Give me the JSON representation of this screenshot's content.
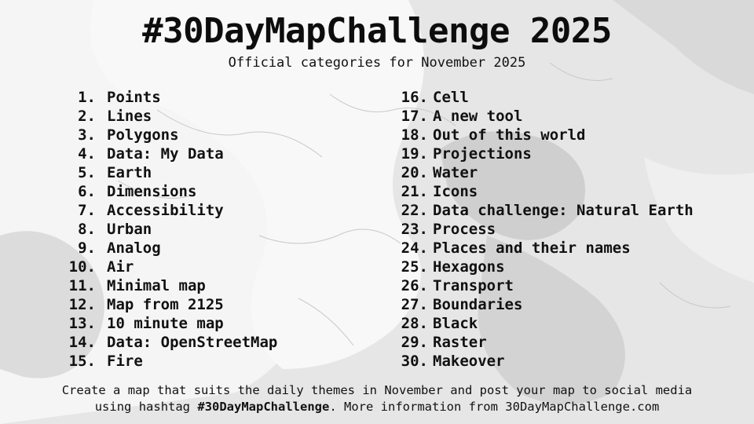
{
  "title": "#30DayMapChallenge 2025",
  "subtitle": "Official categories for November 2025",
  "categories_left": [
    {
      "num": "1.",
      "label": "Points"
    },
    {
      "num": "2.",
      "label": "Lines"
    },
    {
      "num": "3.",
      "label": "Polygons"
    },
    {
      "num": "4.",
      "label": "Data: My Data"
    },
    {
      "num": "5.",
      "label": "Earth"
    },
    {
      "num": "6.",
      "label": "Dimensions"
    },
    {
      "num": "7.",
      "label": "Accessibility"
    },
    {
      "num": "8.",
      "label": "Urban"
    },
    {
      "num": "9.",
      "label": "Analog"
    },
    {
      "num": "10.",
      "label": "Air"
    },
    {
      "num": "11.",
      "label": "Minimal map"
    },
    {
      "num": "12.",
      "label": "Map from 2125"
    },
    {
      "num": "13.",
      "label": "10 minute map"
    },
    {
      "num": "14.",
      "label": "Data: OpenStreetMap"
    },
    {
      "num": "15.",
      "label": "Fire"
    }
  ],
  "categories_right": [
    {
      "num": "16.",
      "label": "Cell"
    },
    {
      "num": "17.",
      "label": "A new tool"
    },
    {
      "num": "18.",
      "label": "Out of this world"
    },
    {
      "num": "19.",
      "label": "Projections"
    },
    {
      "num": "20.",
      "label": "Water"
    },
    {
      "num": "21.",
      "label": "Icons"
    },
    {
      "num": "22.",
      "label": "Data challenge: Natural Earth"
    },
    {
      "num": "23.",
      "label": "Process"
    },
    {
      "num": "24.",
      "label": "Places and their names"
    },
    {
      "num": "25.",
      "label": "Hexagons"
    },
    {
      "num": "26.",
      "label": "Transport"
    },
    {
      "num": "27.",
      "label": "Boundaries"
    },
    {
      "num": "28.",
      "label": "Black"
    },
    {
      "num": "29.",
      "label": "Raster"
    },
    {
      "num": "30.",
      "label": "Makeover"
    }
  ],
  "footer": {
    "line1": "Create a map that suits the daily themes in November and post your map to social media",
    "line2_prefix": "using hashtag ",
    "hashtag": "#30DayMapChallenge",
    "line2_suffix": ". More information from 30DayMapChallenge.com"
  },
  "colors": {
    "background": "#e9e9e9",
    "land_light": "#f6f6f6",
    "land_mid": "#d4d4d4",
    "water": "#c6c6c6",
    "text": "#111111"
  }
}
